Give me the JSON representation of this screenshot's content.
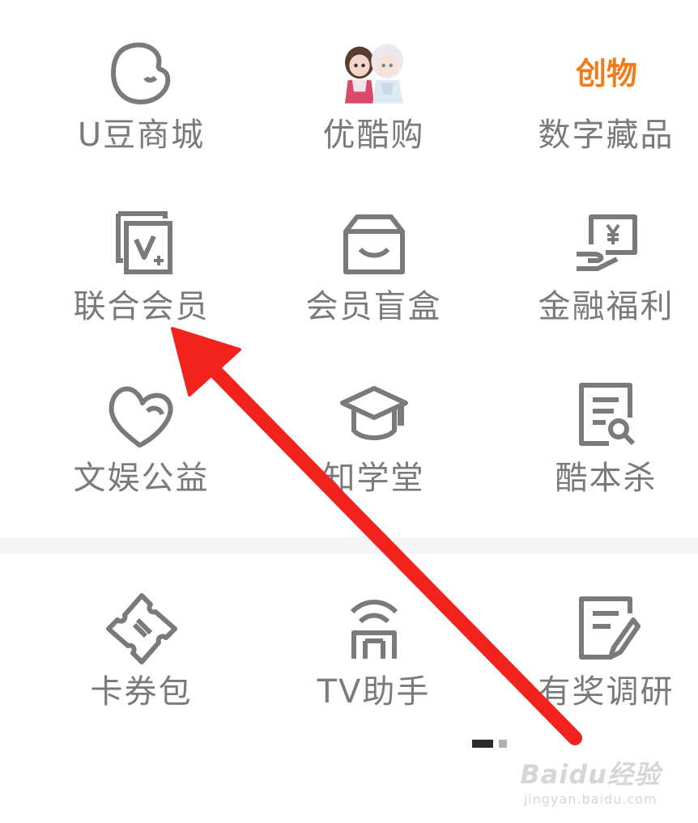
{
  "grid": {
    "items": [
      {
        "label": "U豆商城",
        "icon": "u-bean-icon"
      },
      {
        "label": "优酷购",
        "icon": "cartoon-couple-icon"
      },
      {
        "label": "数字藏品",
        "icon": "chuangwu-logo-icon",
        "icon_text": "创物"
      },
      {
        "label": "联合会员",
        "icon": "joint-vip-icon"
      },
      {
        "label": "会员盲盒",
        "icon": "blind-box-icon"
      },
      {
        "label": "金融福利",
        "icon": "finance-icon"
      },
      {
        "label": "文娱公益",
        "icon": "charity-heart-icon"
      },
      {
        "label": "知学堂",
        "icon": "graduation-cap-icon"
      },
      {
        "label": "酷本杀",
        "icon": "script-search-icon"
      },
      {
        "label": "卡券包",
        "icon": "ticket-icon"
      },
      {
        "label": "TV助手",
        "icon": "tv-assistant-icon"
      },
      {
        "label": "有奖调研",
        "icon": "survey-edit-icon"
      }
    ]
  },
  "pagination": {
    "pages": 2,
    "current": 1
  },
  "watermark": {
    "main": "Baidu经验",
    "sub": "jingyan.baidu.com"
  },
  "colors": {
    "icon_gray": "#7a7a7a",
    "label_gray": "#7a7a7a",
    "accent_orange": "#f07c1e",
    "arrow_red": "#f2231d"
  }
}
